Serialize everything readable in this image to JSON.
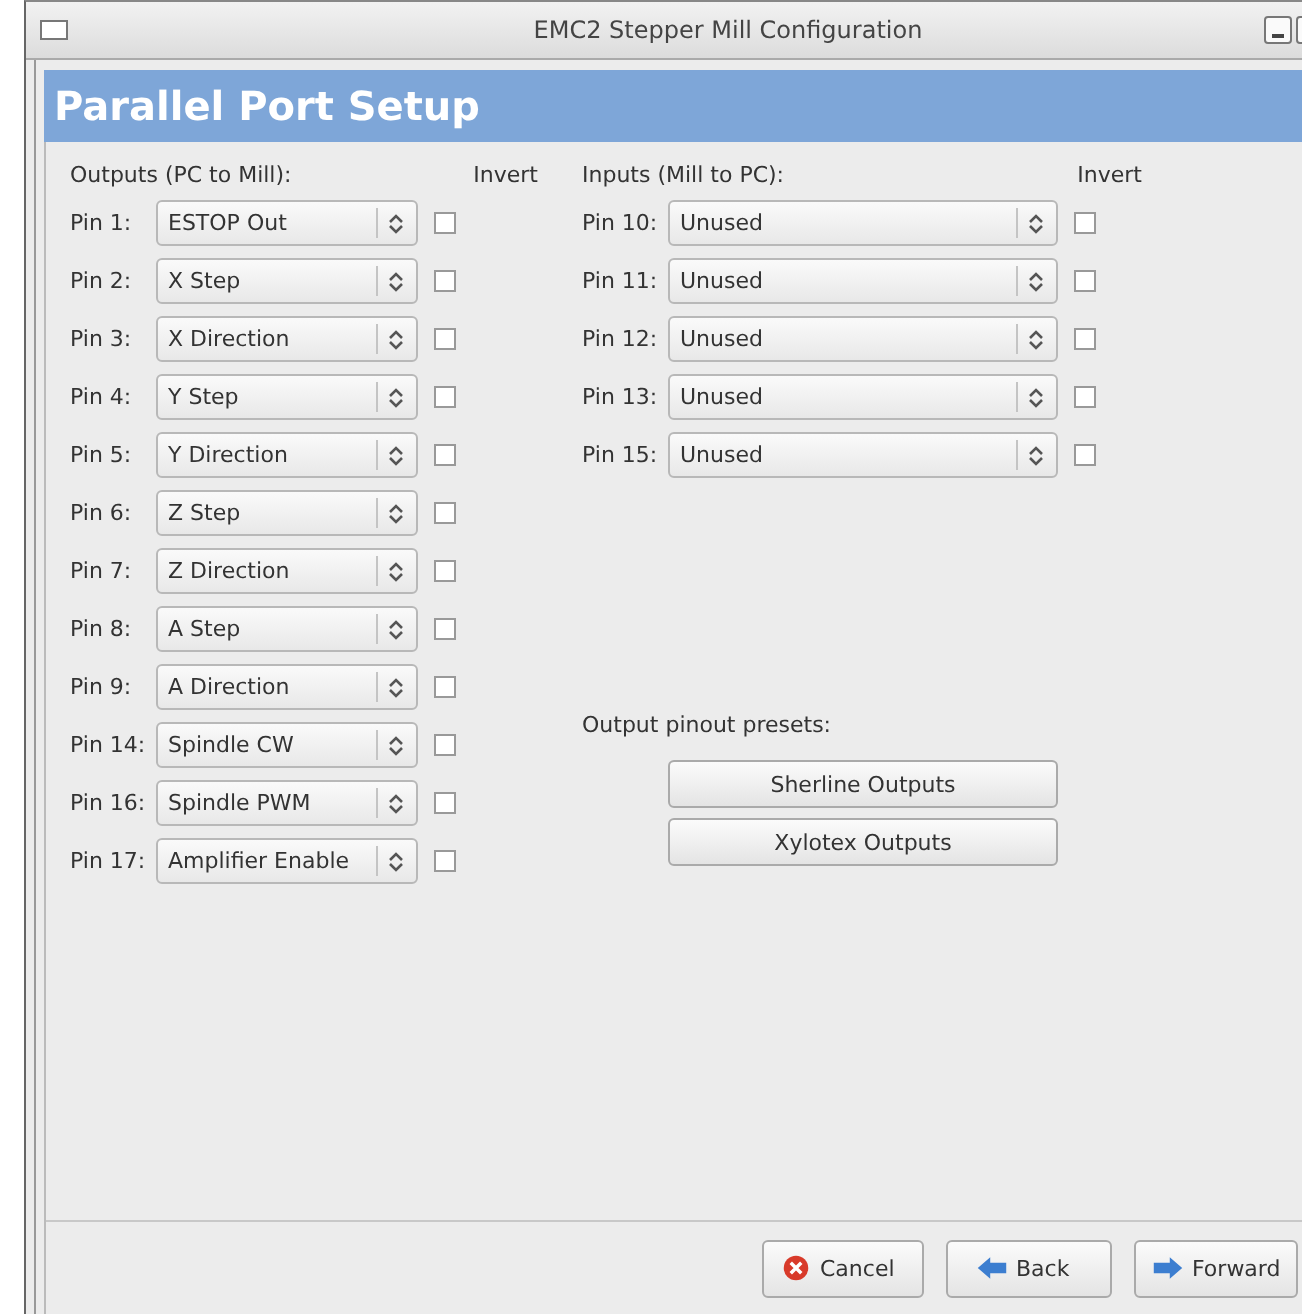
{
  "window": {
    "title": "EMC2 Stepper Mill Configuration"
  },
  "header": "Parallel Port Setup",
  "outputs": {
    "heading": "Outputs (PC to Mill):",
    "invert_heading": "Invert",
    "pins": [
      {
        "label": "Pin 1:",
        "value": "ESTOP Out",
        "invert": false
      },
      {
        "label": "Pin 2:",
        "value": "X Step",
        "invert": false
      },
      {
        "label": "Pin 3:",
        "value": "X Direction",
        "invert": false
      },
      {
        "label": "Pin 4:",
        "value": "Y Step",
        "invert": false
      },
      {
        "label": "Pin 5:",
        "value": "Y Direction",
        "invert": false
      },
      {
        "label": "Pin 6:",
        "value": "Z Step",
        "invert": false
      },
      {
        "label": "Pin 7:",
        "value": "Z Direction",
        "invert": false
      },
      {
        "label": "Pin 8:",
        "value": "A Step",
        "invert": false
      },
      {
        "label": "Pin 9:",
        "value": "A Direction",
        "invert": false
      },
      {
        "label": "Pin 14:",
        "value": "Spindle CW",
        "invert": false
      },
      {
        "label": "Pin 16:",
        "value": "Spindle PWM",
        "invert": false
      },
      {
        "label": "Pin 17:",
        "value": "Amplifier Enable",
        "invert": false
      }
    ]
  },
  "inputs": {
    "heading": "Inputs (Mill to PC):",
    "invert_heading": "Invert",
    "pins": [
      {
        "label": "Pin 10:",
        "value": "Unused",
        "invert": false
      },
      {
        "label": "Pin 11:",
        "value": "Unused",
        "invert": false
      },
      {
        "label": "Pin 12:",
        "value": "Unused",
        "invert": false
      },
      {
        "label": "Pin 13:",
        "value": "Unused",
        "invert": false
      },
      {
        "label": "Pin 15:",
        "value": "Unused",
        "invert": false
      }
    ]
  },
  "presets": {
    "heading": "Output pinout presets:",
    "buttons": [
      "Sherline Outputs",
      "Xylotex Outputs"
    ]
  },
  "footer_buttons": [
    {
      "label": "Cancel",
      "kind": "cancel"
    },
    {
      "label": "Back",
      "kind": "back"
    },
    {
      "label": "Forward",
      "kind": "forward"
    }
  ]
}
